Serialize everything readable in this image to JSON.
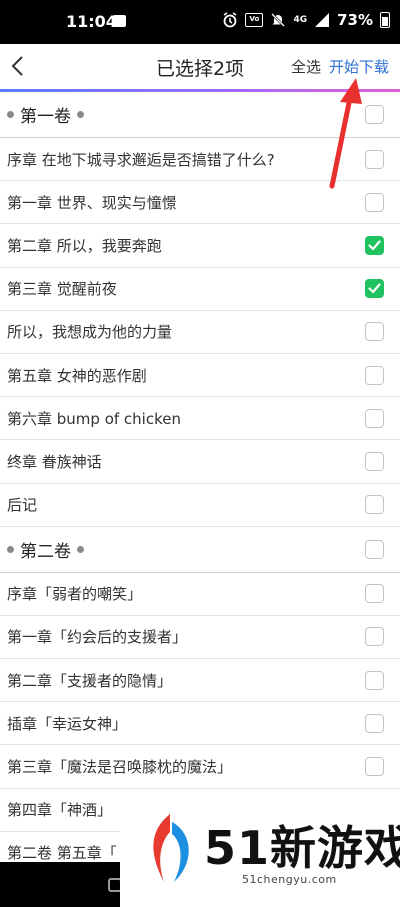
{
  "status_bar": {
    "time": "11:04",
    "network": "4G",
    "battery": "73%"
  },
  "header": {
    "title": "已选择2项",
    "select_all": "全选",
    "start_download": "开始下载"
  },
  "list": [
    {
      "type": "volume",
      "label": "第一卷",
      "checked": false
    },
    {
      "type": "chapter",
      "label": "序章 在地下城寻求邂逅是否搞错了什么?",
      "checked": false
    },
    {
      "type": "chapter",
      "label": "第一章 世界、现实与憧憬",
      "checked": false
    },
    {
      "type": "chapter",
      "label": "第二章 所以，我要奔跑",
      "checked": true
    },
    {
      "type": "chapter",
      "label": "第三章 觉醒前夜",
      "checked": true
    },
    {
      "type": "chapter",
      "label": "所以，我想成为他的力量",
      "checked": false
    },
    {
      "type": "chapter",
      "label": "第五章 女神的恶作剧",
      "checked": false
    },
    {
      "type": "chapter",
      "label": "第六章 bump of chicken",
      "checked": false
    },
    {
      "type": "chapter",
      "label": "终章 眷族神话",
      "checked": false
    },
    {
      "type": "chapter",
      "label": "后记",
      "checked": false
    },
    {
      "type": "volume",
      "label": "第二卷",
      "checked": false
    },
    {
      "type": "chapter",
      "label": "序章「弱者的嘲笑」",
      "checked": false
    },
    {
      "type": "chapter",
      "label": "第一章「约会后的支援者」",
      "checked": false
    },
    {
      "type": "chapter",
      "label": "第二章「支援者的隐情」",
      "checked": false
    },
    {
      "type": "chapter",
      "label": "插章「幸运女神」",
      "checked": false
    },
    {
      "type": "chapter",
      "label": "第三章「魔法是召唤膝枕的魔法」",
      "checked": false
    },
    {
      "type": "chapter",
      "label": "第四章「神酒」",
      "checked": false
    },
    {
      "type": "chapter",
      "label": "第二卷 第五章「",
      "checked": false
    }
  ],
  "watermark": {
    "brand": "51新游戏",
    "url": "51chengyu.com"
  },
  "colors": {
    "accent_blue": "#2f6fd8",
    "check_green": "#1fc25f",
    "arrow_red": "#e8302f"
  }
}
